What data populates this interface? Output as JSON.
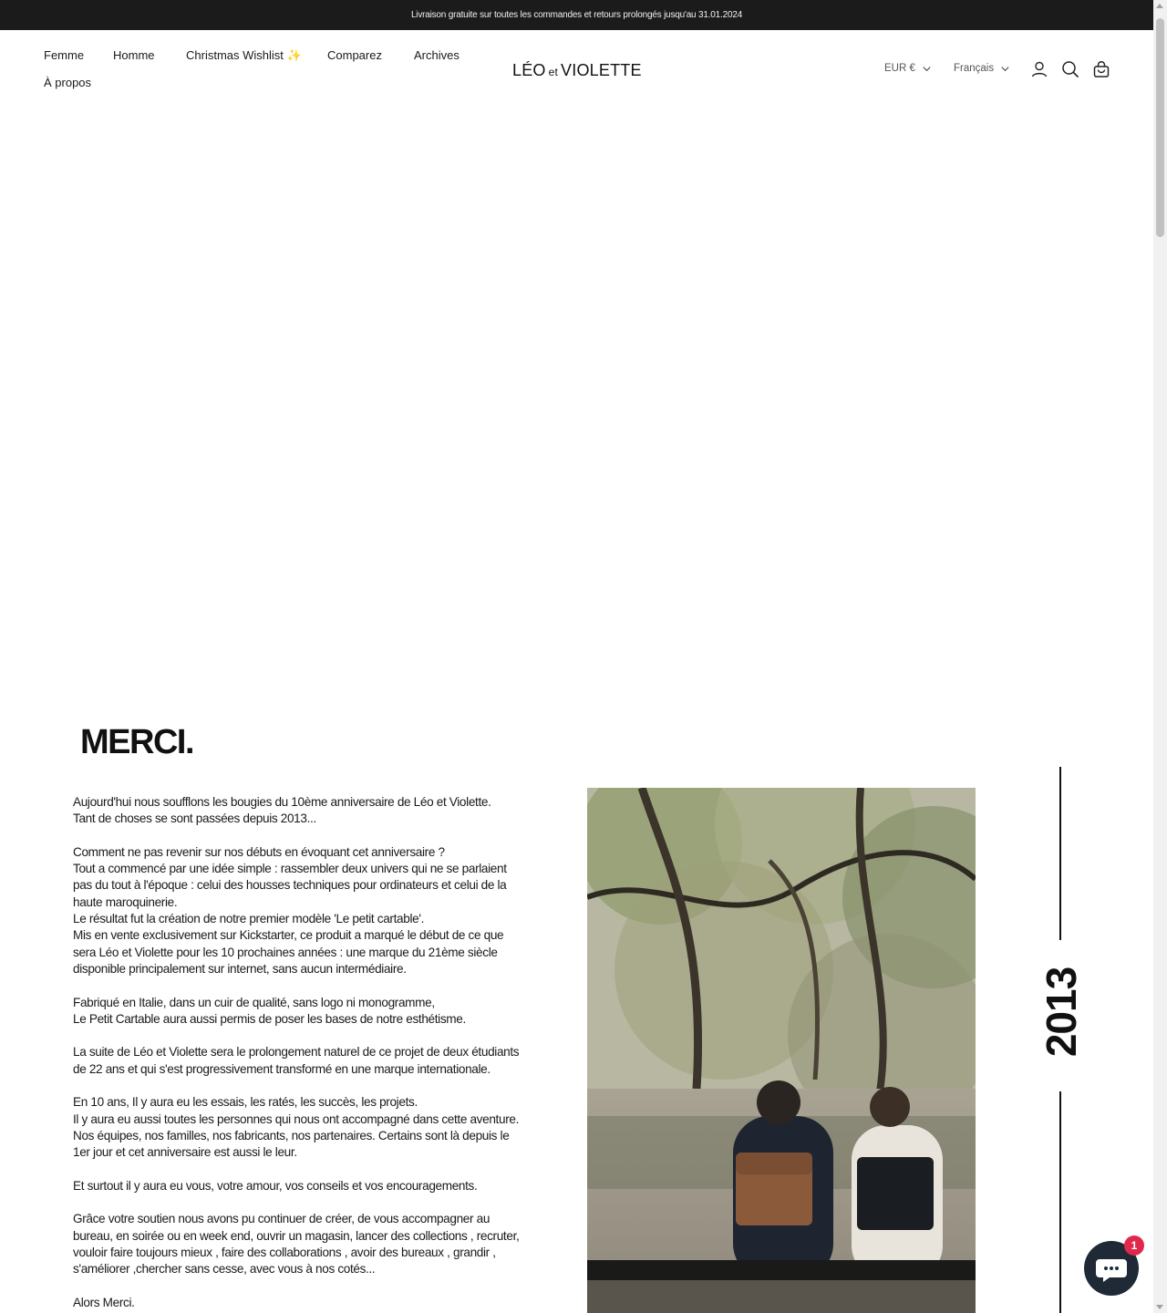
{
  "announcement": {
    "text": "Livraison gratuite sur toutes les commandes et retours prolongés jusqu'au 31.01.2024"
  },
  "header": {
    "nav": [
      "Femme",
      "Homme",
      "Christmas Wishlist ✨",
      "Comparez",
      "Archives",
      "À propos"
    ],
    "logo": {
      "left": "LÉO",
      "middle": "et",
      "right": "VIOLETTE"
    },
    "currency": "EUR €",
    "language": "Français",
    "icons": [
      "account-icon",
      "search-icon",
      "cart-icon"
    ]
  },
  "story": {
    "heading": "MERCI.",
    "lines": [
      "Aujourd'hui nous soufflons les bougies du 10ème anniversaire de Léo et Violette.",
      "Tant de choses se sont passées depuis 2013...",
      "",
      "Comment ne pas revenir sur nos débuts en évoquant cet anniversaire ?",
      "Tout a commencé par une idée simple : rassembler deux univers qui ne se parlaient",
      "pas du tout à l'époque : celui des housses techniques pour ordinateurs et celui de la",
      "haute maroquinerie.",
      "Le résultat fut la création de notre premier modèle 'Le petit cartable'.",
      "Mis en vente exclusivement sur Kickstarter, ce produit a marqué le début de ce que",
      "sera Léo et Violette pour les 10 prochaines années : une marque du 21ème siècle",
      "disponible principalement sur internet, sans aucun intermédiaire.",
      "",
      "Fabriqué en Italie, dans un cuir de qualité, sans logo ni monogramme,",
      "Le Petit Cartable aura aussi permis de poser les bases de notre esthétisme.",
      "",
      "La suite de Léo et Violette sera le prolongement naturel de ce projet de deux étudiants",
      "de 22 ans et qui s'est progressivement transformé en une marque internationale.",
      "",
      "En 10 ans, Il y aura eu les essais, les ratés, les succès, les projets.",
      "Il y aura eu aussi toutes les personnes qui nous ont accompagné dans cette aventure.",
      "Nos équipes, nos familles, nos fabricants, nos partenaires. Certains sont là depuis le",
      "1er jour et cet anniversaire est aussi le leur.",
      "",
      "Et surtout il y aura eu vous, votre amour, vos conseils et vos encouragements.",
      "",
      "Grâce votre soutien nous avons pu continuer de créer, de vous accompagner au",
      "bureau, en soirée ou en week end, ouvrir un magasin, lancer des collections , recruter,",
      "vouloir faire toujours mieux , faire des collaborations , avoir des bureaux , grandir ,",
      "s'améliorer ,chercher sans cesse, avec vous à nos cotés...",
      "",
      "Alors Merci."
    ],
    "year": "2013"
  },
  "chat": {
    "badge_count": "1"
  }
}
